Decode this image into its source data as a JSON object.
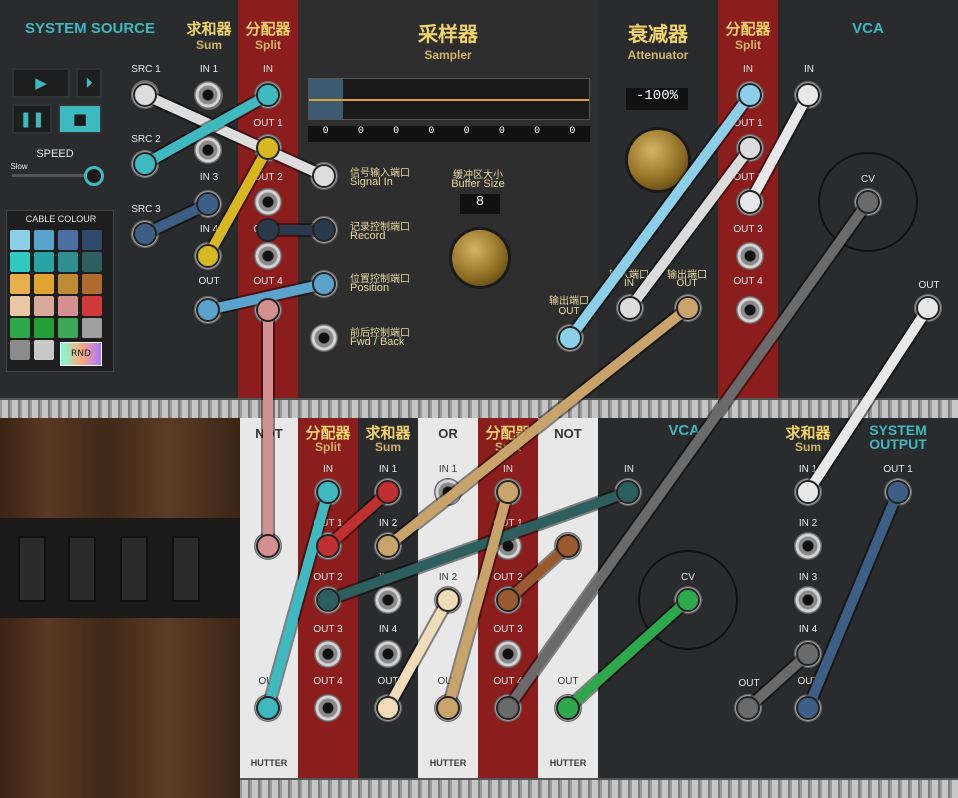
{
  "system_source": {
    "title": "SYSTEM SOURCE",
    "play_icon": "play-icon",
    "step_icon": "step-forward-icon",
    "pause_icon": "pause-icon",
    "stop_icon": "stop-icon",
    "speed_label": "SPEED",
    "speed_slow": "Slow",
    "src_labels": [
      "SRC 1",
      "SRC 2",
      "SRC 3"
    ],
    "cable_colour_label": "CABLE COLOUR",
    "rnd_label": "RND",
    "palette": [
      "#8ccfe9",
      "#5aa3cc",
      "#4b6fa3",
      "#2f4a6b",
      "#2fc9c0",
      "#28a3a3",
      "#2f8f8f",
      "#2e5f5f",
      "#e8b04a",
      "#e0a430",
      "#c08a34",
      "#b06b2e",
      "#e8c7a3",
      "#d6a89a",
      "#d49090",
      "#d03a3a",
      "#2da84a",
      "#249e36",
      "#3ea856",
      "#a0a0a0",
      "#8a8a8a",
      "#c8c8c8"
    ]
  },
  "sum_top": {
    "cn": "求和器",
    "en": "Sum",
    "labels": [
      "IN 1",
      "IN 2",
      "IN 3",
      "IN 4",
      "OUT"
    ]
  },
  "split_top": {
    "cn": "分配器",
    "en": "Split",
    "labels": [
      "IN",
      "OUT 1",
      "OUT 2",
      "OUT 3",
      "OUT 4"
    ]
  },
  "sampler": {
    "cn": "采样器",
    "en": "Sampler",
    "buffer_values": [
      "0",
      "0",
      "0",
      "0",
      "0",
      "0",
      "0",
      "0"
    ],
    "buffer_cn": "缓冲区大小",
    "buffer_en": "Buffer Size",
    "buffer_size": "8",
    "ports": [
      {
        "cn": "信号输入端口",
        "en": "Signal In"
      },
      {
        "cn": "记录控制端口",
        "en": "Record"
      },
      {
        "cn": "位置控制端口",
        "en": "Position"
      },
      {
        "cn": "前后控制端口",
        "en": "Fwd / Back"
      }
    ],
    "out_cn": "输出端口",
    "out_en": "OUT"
  },
  "attenuator": {
    "cn": "衰减器",
    "en": "Attenuator",
    "value": "-100%",
    "in_cn": "输入端口",
    "in_en": "IN",
    "out_cn": "输出端口",
    "out_en": "OUT"
  },
  "split_top2": {
    "cn": "分配器",
    "en": "Split",
    "labels": [
      "IN",
      "OUT 1",
      "OUT 2",
      "OUT 3",
      "OUT 4"
    ]
  },
  "vca_top": {
    "title": "VCA",
    "in": "IN",
    "cv": "CV",
    "out": "OUT"
  },
  "not1": {
    "title": "NOT",
    "out": "OUT",
    "brand": "HUTTER"
  },
  "split_bottom": {
    "cn": "分配器",
    "en": "Split",
    "labels": [
      "IN",
      "OUT 1",
      "OUT 2",
      "OUT 3",
      "OUT 4"
    ]
  },
  "sum_bottom": {
    "cn": "求和器",
    "en": "Sum",
    "labels": [
      "IN 1",
      "IN 2",
      "IN 3",
      "IN 4",
      "OUT"
    ]
  },
  "or": {
    "title": "OR",
    "labels": [
      "IN 1",
      "IN 2",
      "OUT"
    ],
    "brand": "HUTTER"
  },
  "split_bottom2": {
    "cn": "分配器",
    "en": "Split",
    "labels": [
      "IN",
      "OUT 1",
      "OUT 2",
      "OUT 3",
      "OUT 4"
    ]
  },
  "not2": {
    "title": "NOT",
    "out": "OUT",
    "brand": "HUTTER"
  },
  "vca_bottom": {
    "title": "VCA",
    "in": "IN",
    "cv": "CV",
    "out": "OUT"
  },
  "sum_bottom2": {
    "cn": "求和器",
    "en": "Sum",
    "labels": [
      "IN 1",
      "IN 2",
      "IN 3",
      "IN 4",
      "OUT"
    ]
  },
  "system_output": {
    "title_1": "SYSTEM",
    "title_2": "OUTPUT",
    "out1": "OUT 1"
  },
  "colors": {
    "teal": "#3fb9c0",
    "gold": "#f1d36b",
    "red_panel": "#8c1d1d"
  }
}
